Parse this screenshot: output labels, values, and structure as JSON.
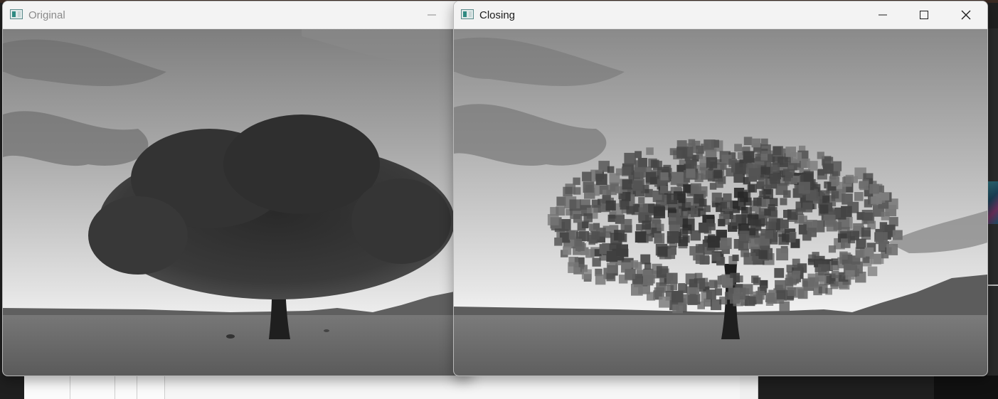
{
  "windows": {
    "original": {
      "title": "Original",
      "icon": "opencv-window-icon"
    },
    "closing": {
      "title": "Closing",
      "icon": "opencv-window-icon"
    }
  },
  "controls": {
    "minimize_icon": "minimize-icon",
    "maximize_icon": "maximize-icon",
    "close_icon": "close-icon"
  }
}
